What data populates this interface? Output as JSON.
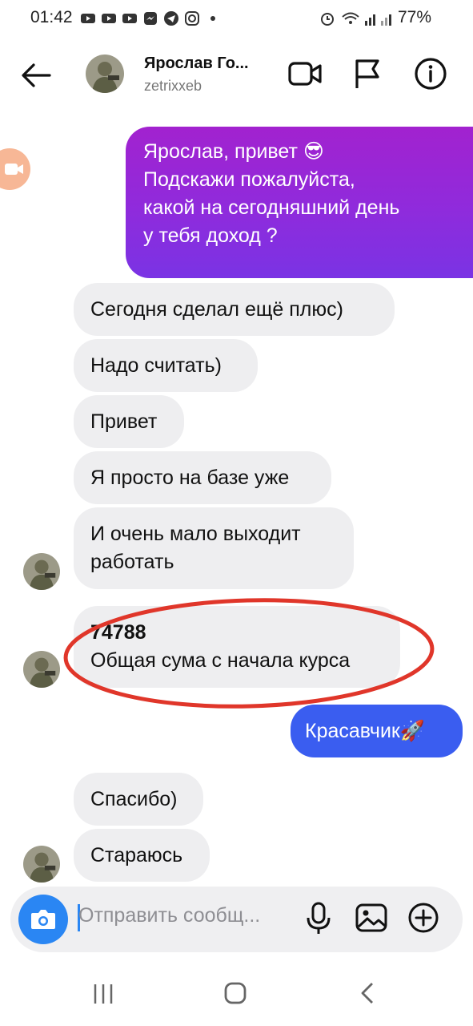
{
  "status_bar": {
    "time": "01:42",
    "battery": "77%"
  },
  "header": {
    "name": "Ярослав Го...",
    "handle": "zetrixxeb"
  },
  "messages": {
    "outgoing_1": [
      "Ярослав, привет 😎",
      "Подскажи пожалуйста,",
      "какой на сегодняшний день",
      "у тебя доход ?"
    ],
    "in_1": "Сегодня сделал ещё плюс)",
    "in_2": "Надо считать)",
    "in_3": "Привет",
    "in_4": "Я просто на базе уже",
    "in_5": [
      "И очень мало выходит",
      "работать"
    ],
    "in_6_amount": "74788",
    "in_6_text": "Общая сума с начала курса",
    "outgoing_2": "Красавчик🚀",
    "in_7": "Спасибо)",
    "in_8": "Стараюсь"
  },
  "composer": {
    "placeholder": "Отправить сообщ..."
  },
  "colors": {
    "outgoing_gradient_top": "#a222cf",
    "outgoing_gradient_bottom": "#7a33e4",
    "outgoing_blue": "#3a5df0",
    "incoming": "#eeeef0",
    "highlight": "#e0362a",
    "camera_button": "#2a86f3"
  }
}
